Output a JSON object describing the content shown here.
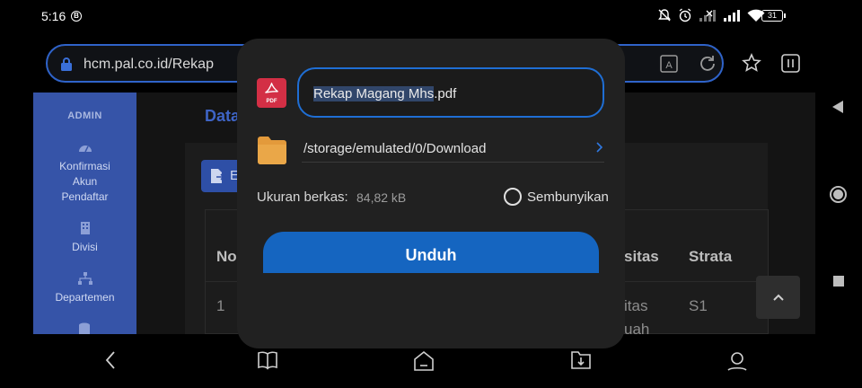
{
  "status": {
    "time": "5:16",
    "notif_badge": "B",
    "battery": "31"
  },
  "browser": {
    "url": "hcm.pal.co.id/Rekap"
  },
  "sidebar": {
    "title": "ADMIN",
    "items": [
      {
        "label": "Konfirmasi Akun Pendaftar"
      },
      {
        "label": "Divisi"
      },
      {
        "label": "Departemen"
      }
    ]
  },
  "page": {
    "title": "Data",
    "excel_btn": "E",
    "table": {
      "headers": [
        "No",
        "sitas",
        "Strata"
      ],
      "row1": [
        "1",
        "itas",
        "S1"
      ],
      "row1_sub": "uah"
    }
  },
  "dialog": {
    "filename_selected": "Rekap Magang Mhs",
    "filename_ext": ".pdf",
    "pdf_badge": "PDF",
    "path": "/storage/emulated/0/Download",
    "size_label": "Ukuran berkas:",
    "size_value": "84,82 kB",
    "hide_label": "Sembunyikan",
    "download_button": "Unduh"
  },
  "colors": {
    "accent": "#1565c0",
    "sidebar": "#3654a8",
    "pdf": "#d32f45",
    "folder": "#e39a3b"
  }
}
